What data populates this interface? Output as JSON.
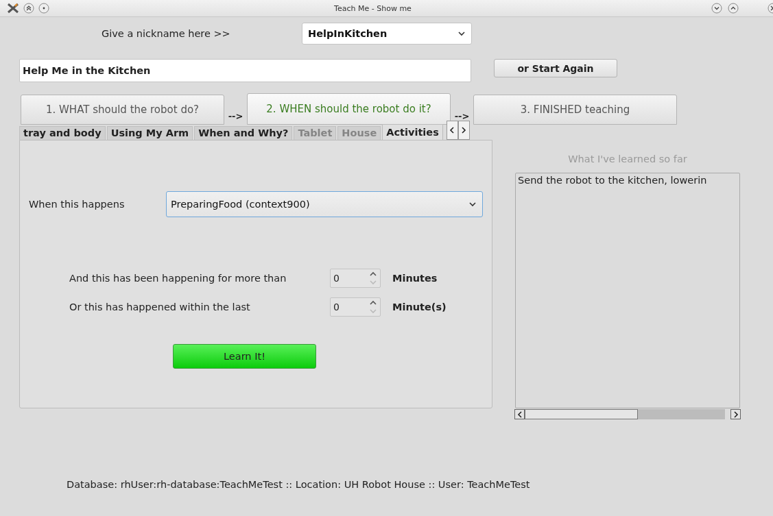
{
  "window": {
    "title": "Teach Me - Show me"
  },
  "nickname": {
    "label": "Give a nickname here >>",
    "value": "HelpInKitchen"
  },
  "task_name": {
    "value": "Help Me in the Kitchen"
  },
  "start_again_button": "or Start Again",
  "steps": [
    {
      "label": "1. WHAT should the robot do?",
      "selected": false
    },
    {
      "label": "2. WHEN should the robot do it?",
      "selected": true
    },
    {
      "label": "3. FINISHED teaching",
      "selected": false
    }
  ],
  "step_arrows": [
    "-->",
    "-->"
  ],
  "tabs": [
    {
      "label": "tray and body",
      "selected": false,
      "disabled": false
    },
    {
      "label": "Using My Arm",
      "selected": false,
      "disabled": false
    },
    {
      "label": "When and Why?",
      "selected": false,
      "disabled": false
    },
    {
      "label": "Tablet",
      "selected": false,
      "disabled": true
    },
    {
      "label": "House",
      "selected": false,
      "disabled": true
    },
    {
      "label": "Activities",
      "selected": true,
      "disabled": false
    }
  ],
  "condition": {
    "label": "When this happens",
    "value": "PreparingFood (context900)"
  },
  "durations": [
    {
      "label": "And this has been happening for more than",
      "value": "0",
      "unit": "Minutes"
    },
    {
      "label": "Or this has happened within the last",
      "value": "0",
      "unit": "Minute(s)"
    }
  ],
  "learn_button": "Learn It!",
  "learned": {
    "heading": "What I've learned so far",
    "text": "Send the robot to the kitchen, lowerin"
  },
  "status": "Database: rhUser:rh-database:TeachMeTest :: Location: UH Robot House :: User: TeachMeTest"
}
